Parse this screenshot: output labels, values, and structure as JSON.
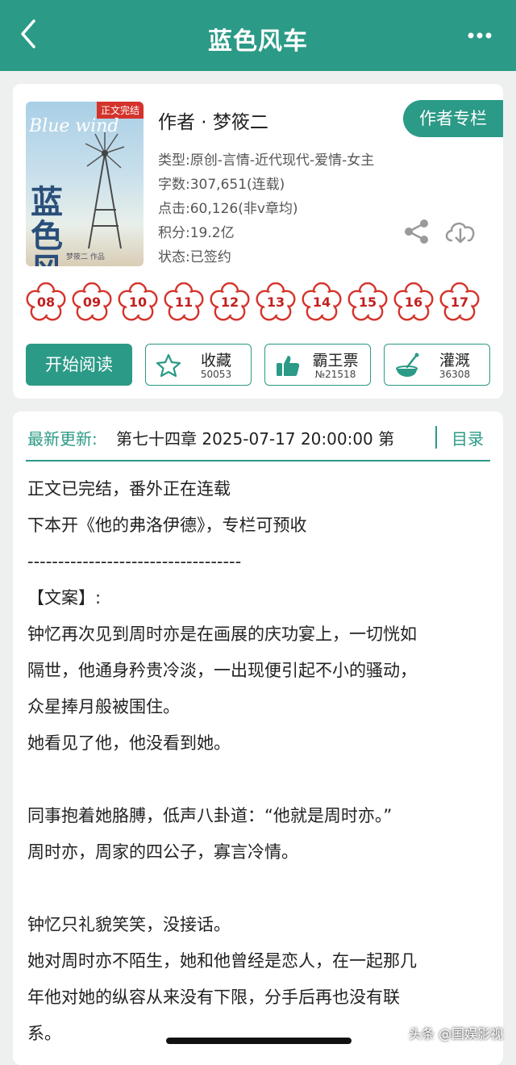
{
  "header": {
    "title": "蓝色风车"
  },
  "book": {
    "cover_tag": "正文完结",
    "cover_en": "Blue wind",
    "cover_cn": "蓝色风车",
    "cover_small": "梦筱二 作品",
    "author": "作者 · 梦筱二",
    "author_column_label": "作者专栏",
    "type": "类型:原创-言情-近代现代-爱情-女主",
    "words": "字数:307,651(连载)",
    "clicks": "点击:60,126(非v章均)",
    "score": "积分:19.2亿",
    "status": "状态:已签约"
  },
  "badges": [
    "08",
    "09",
    "10",
    "11",
    "12",
    "13",
    "14",
    "15",
    "16",
    "17"
  ],
  "actions": {
    "read_label": "开始阅读",
    "favorite": {
      "label": "收藏",
      "count": "50053"
    },
    "ticket": {
      "label": "霸王票",
      "count": "№21518"
    },
    "water": {
      "label": "灌溉",
      "count": "36308"
    }
  },
  "update": {
    "label": "最新更新:",
    "value": "第七十四章 2025-07-17 20:00:00   第",
    "toc_label": "目录"
  },
  "description": [
    "正文已完结，番外正在连载",
    "下本开《他的弗洛伊德》，专栏可预收",
    "-----------------------------------",
    "【文案】:",
    "钟忆再次见到周时亦是在画展的庆功宴上，一切恍如",
    "隔世，他通身矜贵冷淡，一出现便引起不小的骚动，",
    "众星捧月般被围住。",
    "她看见了他，他没看到她。",
    "",
    "同事抱着她胳膊，低声八卦道：“他就是周时亦。”",
    "周时亦，周家的四公子，寡言冷情。",
    "",
    "钟忆只礼貌笑笑，没接话。",
    "她对周时亦不陌生，她和他曾经是恋人，在一起那几",
    "年他对她的纵容从来没有下限，分手后再也没有联",
    "系。"
  ],
  "watermark": "头条 @国娱影视",
  "colors": {
    "accent": "#2b9a86",
    "badge": "#d4332b"
  }
}
